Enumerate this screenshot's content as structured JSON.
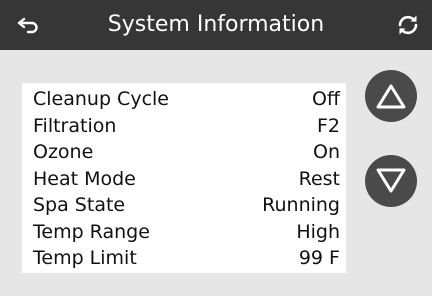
{
  "header": {
    "title": "System Information",
    "back_icon": "back-arrow-icon",
    "refresh_icon": "refresh-icon"
  },
  "info": {
    "rows": [
      {
        "label": "Cleanup Cycle",
        "value": "Off"
      },
      {
        "label": "Filtration",
        "value": "F2"
      },
      {
        "label": "Ozone",
        "value": "On"
      },
      {
        "label": "Heat Mode",
        "value": "Rest"
      },
      {
        "label": "Spa State",
        "value": "Running"
      },
      {
        "label": "Temp Range",
        "value": "High"
      },
      {
        "label": "Temp Limit",
        "value": "99 F"
      }
    ]
  },
  "controls": {
    "up_icon": "triangle-up-icon",
    "down_icon": "triangle-down-icon"
  },
  "colors": {
    "header_bg": "#363636",
    "page_bg": "#e6e6e6",
    "panel_bg": "#ffffff",
    "button_bg": "#4a4a4a",
    "icon": "#ffffff"
  }
}
